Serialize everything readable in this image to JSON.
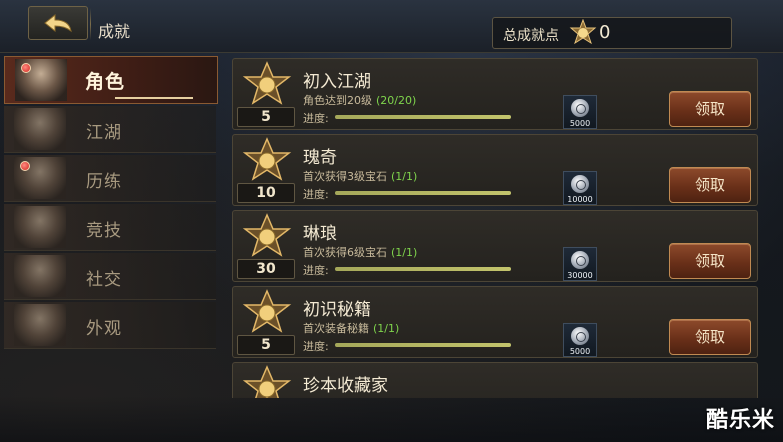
{
  "header": {
    "title": "成就",
    "total_points_label": "总成就点",
    "total_points_value": "0"
  },
  "sidebar": {
    "tabs": [
      {
        "label": "角色",
        "active": true,
        "red_dot": true
      },
      {
        "label": "江湖",
        "active": false,
        "red_dot": false
      },
      {
        "label": "历练",
        "active": false,
        "red_dot": true
      },
      {
        "label": "竞技",
        "active": false,
        "red_dot": false
      },
      {
        "label": "社交",
        "active": false,
        "red_dot": false
      },
      {
        "label": "外观",
        "active": false,
        "red_dot": false
      }
    ]
  },
  "achievements": [
    {
      "level": "5",
      "title": "初入江湖",
      "desc": "角色达到20级",
      "count": "(20/20)",
      "progress_label": "进度:",
      "progress": 1.0,
      "reward_icon": "silver-coin-icon",
      "reward_amount": "5000",
      "button": "领取"
    },
    {
      "level": "10",
      "title": "瑰奇",
      "desc": "首次获得3级宝石",
      "count": "(1/1)",
      "progress_label": "进度:",
      "progress": 1.0,
      "reward_icon": "silver-coin-icon",
      "reward_amount": "10000",
      "button": "领取"
    },
    {
      "level": "30",
      "title": "琳琅",
      "desc": "首次获得6级宝石",
      "count": "(1/1)",
      "progress_label": "进度:",
      "progress": 1.0,
      "reward_icon": "silver-coin-icon",
      "reward_amount": "30000",
      "button": "领取"
    },
    {
      "level": "5",
      "title": "初识秘籍",
      "desc": "首次装备秘籍",
      "count": "(1/1)",
      "progress_label": "进度:",
      "progress": 1.0,
      "reward_icon": "silver-coin-icon",
      "reward_amount": "5000",
      "button": "领取"
    },
    {
      "level": "",
      "title": "珍本收藏家",
      "desc": "",
      "count": "",
      "progress_label": "",
      "progress": 0,
      "reward_icon": "",
      "reward_amount": "",
      "button": ""
    }
  ],
  "watermark": "酷乐米",
  "colors": {
    "accent_gold": "#c08a52",
    "progress_green": "#7fd44c",
    "active_tab": "#5a2a1c"
  }
}
